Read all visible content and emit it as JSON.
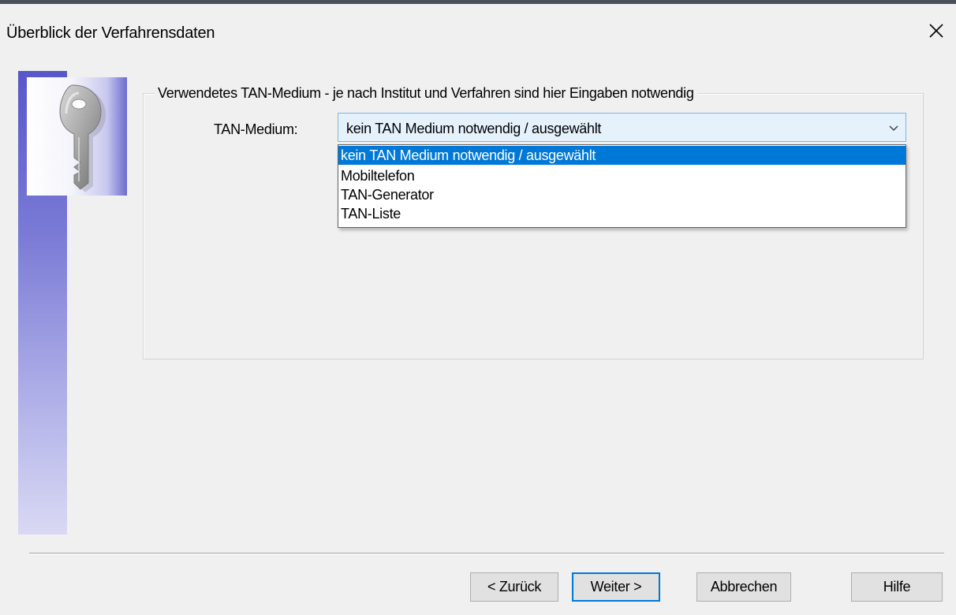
{
  "window": {
    "title": "Überblick der Verfahrensdaten",
    "close_icon": "close-icon"
  },
  "sidebar": {
    "icon": "key-icon"
  },
  "group": {
    "legend": "Verwendetes TAN-Medium - je nach Institut und Verfahren sind hier Eingaben notwendig",
    "field_label": "TAN-Medium:",
    "combo": {
      "value": "kein TAN Medium notwendig / ausgewählt",
      "arrow_icon": "chevron-down-icon",
      "options": [
        "kein TAN Medium notwendig / ausgewählt",
        "Mobiltelefon",
        "TAN-Generator",
        "TAN-Liste"
      ],
      "selected_index": 0
    }
  },
  "footer": {
    "back": "< Zurück",
    "next": "Weiter >",
    "cancel": "Abbrechen",
    "help": "Hilfe"
  },
  "colors": {
    "selection": "#0078d7",
    "combo_bg": "#e5f1fb",
    "combo_border": "#7eb4ea",
    "sidebar_gradient_top": "#5757c8"
  }
}
